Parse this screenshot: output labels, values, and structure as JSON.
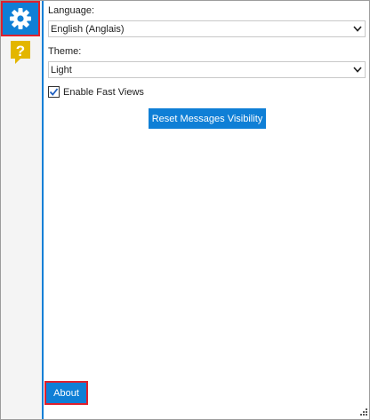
{
  "sidebar": {
    "items": [
      {
        "icon": "gear-icon",
        "selected": true
      },
      {
        "icon": "help-question-icon",
        "selected": false
      }
    ]
  },
  "settings": {
    "language_label": "Language:",
    "language_value": "English (Anglais)",
    "theme_label": "Theme:",
    "theme_value": "Light",
    "fast_views_label": "Enable Fast Views",
    "fast_views_checked": true,
    "reset_button": "Reset Messages Visibility",
    "about_button": "About"
  },
  "colors": {
    "accent": "#0f7fd6",
    "highlight": "#e0202c",
    "help_icon": "#e3b600"
  }
}
